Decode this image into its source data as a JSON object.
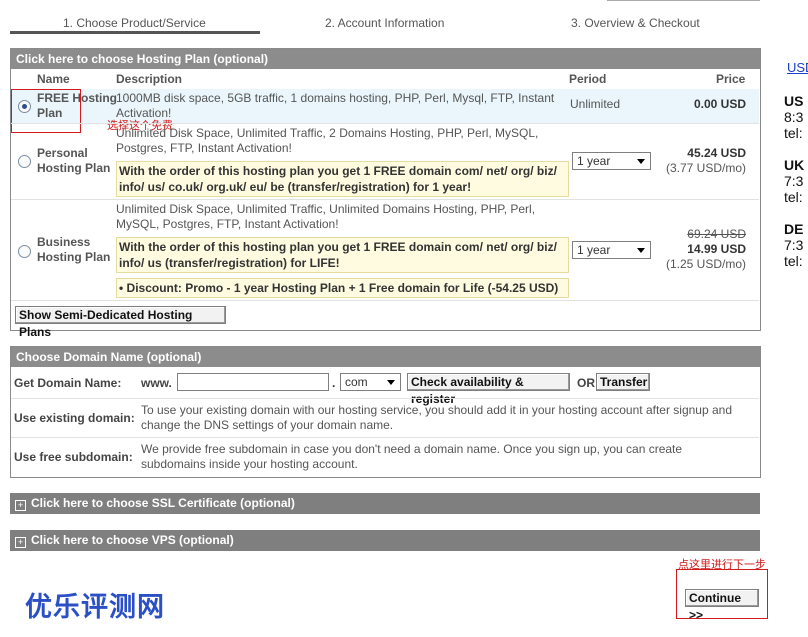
{
  "steps": [
    "1. Choose Product/Service",
    "2. Account Information",
    "3. Overview & Checkout"
  ],
  "hosting": {
    "header": "Click here to choose Hosting Plan (optional)",
    "columns": {
      "name": "Name",
      "description": "Description",
      "period": "Period",
      "price": "Price"
    },
    "plans": [
      {
        "name_line1": "FREE Hosting",
        "name_line2": "Plan",
        "desc_line1": "1000MB disk space, 5GB traffic, 1 domains hosting, PHP, Perl, Mysql, FTP, Instant",
        "desc_line2": "Activation!",
        "period": "Unlimited",
        "price": "0.00 USD",
        "selected": true
      },
      {
        "name_line1": "Personal",
        "name_line2": "Hosting Plan",
        "desc_line1": "Unlimited Disk Space, Unlimited Traffic, 2 Domains Hosting, PHP, Perl, MySQL,",
        "desc_line2": "Postgres, FTP, Instant Activation!",
        "promo_line1": "With the order of this hosting plan you get 1 FREE domain com/ net/ org/ biz/",
        "promo_line2": "info/ us/ co.uk/ org.uk/ eu/ be (transfer/registration) for 1 year!",
        "period": "1 year",
        "price": "45.24 USD",
        "price_monthly": "(3.77 USD/mo)",
        "selected": false
      },
      {
        "name_line1": "Business",
        "name_line2": "Hosting Plan",
        "desc_line1": "Unlimited Disk Space, Unlimited Traffic, Unlimited Domains Hosting, PHP, Perl,",
        "desc_line2": "MySQL, Postgres, FTP, Instant Activation!",
        "promo_line1": "With the order of this hosting plan you get 1 FREE domain com/ net/ org/ biz/",
        "promo_line2": "info/ us (transfer/registration) for LIFE!",
        "discount": "• Discount: Promo - 1 year Hosting Plan + 1 Free domain for Life (-54.25 USD)",
        "period": "1 year",
        "price_old": "69.24 USD",
        "price": "14.99 USD",
        "price_monthly": "(1.25 USD/mo)",
        "selected": false
      }
    ],
    "semi_dedicated_button": "Show Semi-Dedicated Hosting Plans"
  },
  "annotations": {
    "free_note": "选择这个免费",
    "continue_note": "点这里进行下一步"
  },
  "domain": {
    "header": "Choose Domain Name (optional)",
    "get_label": "Get Domain Name:",
    "www": "www.",
    "dot": ".",
    "tld": "com",
    "check_button": "Check availability & register",
    "or": "OR",
    "transfer_button": "Transfer",
    "existing_label": "Use existing domain:",
    "existing_line1": "To use your existing domain with our hosting service, you should add it in your hosting account after signup and",
    "existing_line2": "change the DNS settings of your domain name.",
    "subdomain_label": "Use free subdomain:",
    "subdomain_line1": "We provide free subdomain in case you don't need a domain name. Once you sign up, you can create",
    "subdomain_line2": "subdomains inside your hosting account."
  },
  "ssl_header": "Click here to choose SSL Certificate (optional)",
  "vps_header": "Click here to choose VPS (optional)",
  "continue_button": "Continue >>",
  "logo_text": "优乐评测网",
  "sidebar": {
    "currency_link": "USD",
    "regions": [
      {
        "code": "US",
        "line1": "8:3",
        "line2": "tel:"
      },
      {
        "code": "UK",
        "line1": "7:3",
        "line2": "tel:"
      },
      {
        "code": "DE",
        "line1": "7:3",
        "line2": "tel:"
      }
    ]
  },
  "colors": {
    "header_bg": "#8c8c8c",
    "annotation_red": "#d21a1a",
    "logo_blue": "#2b50c6",
    "free_row_bg": "#eaf6fb"
  }
}
